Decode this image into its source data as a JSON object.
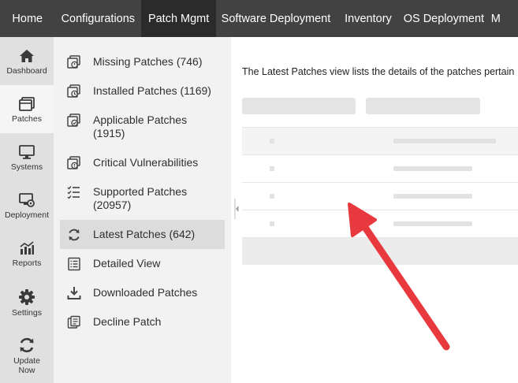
{
  "topnav": {
    "tabs": [
      {
        "label": "Home"
      },
      {
        "label": "Configurations"
      },
      {
        "label": "Patch Mgmt"
      },
      {
        "label": "Software Deployment"
      },
      {
        "label": "Inventory"
      },
      {
        "label": "OS Deployment"
      },
      {
        "label": "M"
      }
    ]
  },
  "rail": {
    "items": [
      {
        "label": "Dashboard",
        "icon": "home-icon"
      },
      {
        "label": "Patches",
        "icon": "patches-icon"
      },
      {
        "label": "Systems",
        "icon": "monitor-icon"
      },
      {
        "label": "Deployment",
        "icon": "deployment-icon"
      },
      {
        "label": "Reports",
        "icon": "reports-icon"
      },
      {
        "label": "Settings",
        "icon": "gear-icon"
      },
      {
        "label": "Update",
        "label2": "Now",
        "icon": "refresh-icon"
      }
    ]
  },
  "submenu": {
    "items": [
      {
        "line1": "Missing Patches (746)"
      },
      {
        "line1": "Installed Patches (1169)"
      },
      {
        "line1": "Applicable Patches",
        "line2": "(1915)"
      },
      {
        "line1": "Critical Vulnerabilities"
      },
      {
        "line1": "Supported Patches",
        "line2": "(20957)"
      },
      {
        "line1": "Latest Patches (642)"
      },
      {
        "line1": "Detailed View"
      },
      {
        "line1": "Downloaded Patches"
      },
      {
        "line1": "Decline Patch"
      }
    ]
  },
  "main": {
    "intro": "The Latest Patches view lists the details of the patches pertain"
  },
  "colors": {
    "topnav_bg": "#424242",
    "topnav_active": "#2b2b2b",
    "rail_bg": "#e0e0e0",
    "submenu_bg": "#f2f2f2",
    "arrow": "#e8393f"
  }
}
